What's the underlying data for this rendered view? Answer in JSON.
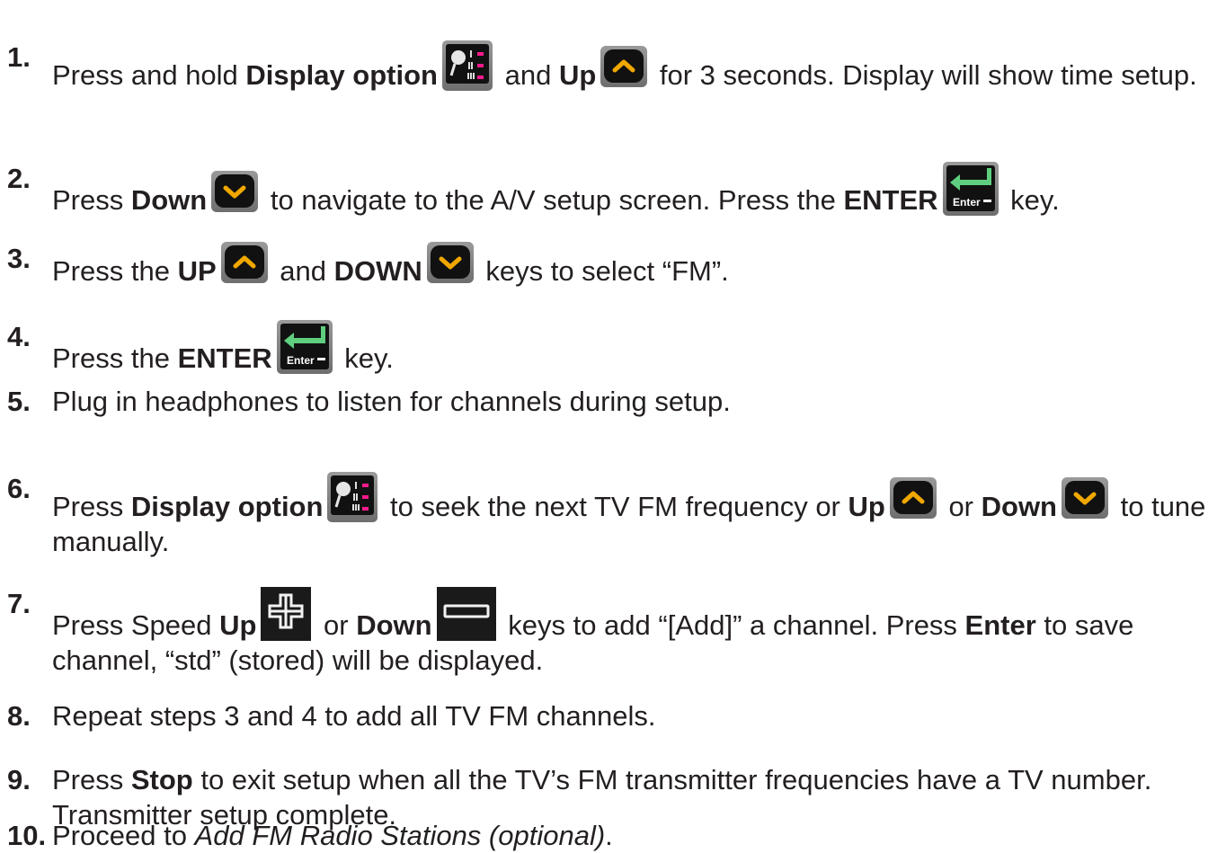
{
  "steps": [
    {
      "num": "1.",
      "t": [
        "Press and hold ",
        "Display option",
        " and ",
        "Up",
        " for 3 seconds. Display will show time setup."
      ]
    },
    {
      "num": "2.",
      "t": [
        "Press ",
        "Down",
        " to navigate to the A/V setup screen. Press the ",
        "ENTER",
        " key."
      ]
    },
    {
      "num": "3.",
      "t": [
        "Press the ",
        "UP",
        " and ",
        "DOWN",
        " keys to select “FM”."
      ]
    },
    {
      "num": "4.",
      "t": [
        "Press the ",
        "ENTER",
        " key."
      ]
    },
    {
      "num": "5.",
      "t": [
        "Plug in headphones to listen for channels during setup."
      ]
    },
    {
      "num": "6.",
      "t": [
        "Press ",
        "Display option",
        " to seek the next TV FM frequency or ",
        "Up",
        " or ",
        "Down",
        " to tune manually."
      ]
    },
    {
      "num": "7.",
      "t": [
        "Press Speed ",
        "Up",
        " or ",
        "Down",
        " keys to add “[Add]” a channel. Press ",
        "Enter",
        " to save channel, “std” (stored) will be displayed."
      ]
    },
    {
      "num": "8.",
      "t": [
        "Repeat steps 3 and 4 to add all TV FM channels."
      ]
    },
    {
      "num": "9.",
      "t": [
        "Press ",
        "Stop",
        " to exit setup when all the TV’s FM transmitter frequencies have a TV number. Transmitter setup complete."
      ]
    },
    {
      "num": "10.",
      "t": [
        "Proceed to ",
        "Add FM Radio Stations (optional)",
        "."
      ]
    }
  ],
  "enter_key_label": "Enter",
  "icons": {
    "display": "display-option-key-icon",
    "up": "up-arrow-key-icon",
    "down": "down-arrow-key-icon",
    "enter": "enter-key-icon",
    "plus": "speed-up-plus-key-icon",
    "minus": "speed-down-minus-key-icon"
  },
  "colors": {
    "text": "#231f20",
    "key_bg": "#111111",
    "enter_arrow": "#5fcf7f",
    "display_marks": "#ff1a8c",
    "arrow": "#f0a800"
  }
}
